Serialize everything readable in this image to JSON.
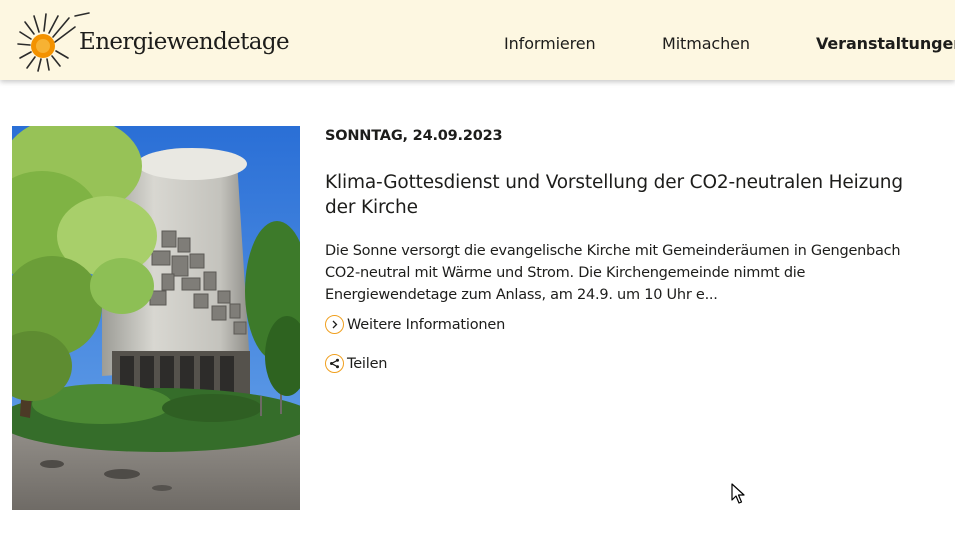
{
  "header": {
    "logo_text": "Energiewendetage",
    "nav": [
      {
        "label": "Informieren",
        "active": false
      },
      {
        "label": "Mitmachen",
        "active": false
      },
      {
        "label": "Veranstaltungen",
        "active": true
      }
    ]
  },
  "event": {
    "date": "SONNTAG, 24.09.2023",
    "title": "Klima-Gottesdienst und Vorstellung der CO2-neutralen Heizung der Kirche",
    "description": "Die Sonne versorgt die evangelische Kirche mit Gemeinderäumen in Gengenbach CO2-neutral mit Wärme und Strom. Die Kirchengemeinde nimmt die Energiewendetage zum Anlass, am 24.9. um 10 Uhr e...",
    "more_label": "Weitere Informationen",
    "share_label": "Teilen"
  },
  "icons": {
    "logo": "sun-icon",
    "more": "chevron-right-icon",
    "share": "share-icon",
    "cursor": "mouse-pointer-icon"
  },
  "colors": {
    "header_bg": "#fdf7e1",
    "accent": "#f0a020",
    "text": "#1d1d1b",
    "sun": "#f39200"
  }
}
